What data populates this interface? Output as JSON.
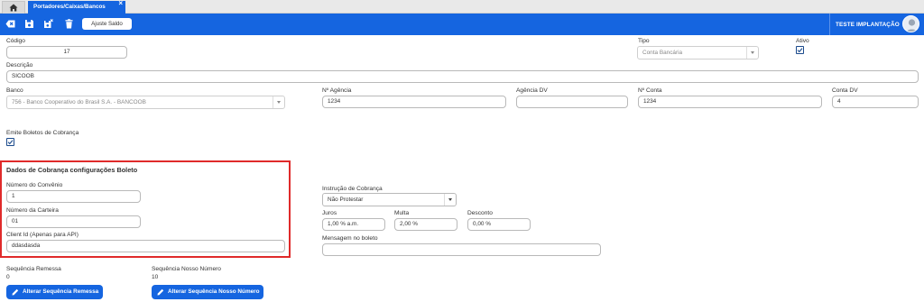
{
  "tabs": {
    "home_icon": "home-icon",
    "active_label": "Portadores/Caixas/Bancos",
    "close_glyph": "×"
  },
  "toolbar": {
    "icons": [
      "cancel-icon",
      "save-icon",
      "save-close-icon",
      "delete-icon"
    ],
    "ajuste_saldo_label": "Ajuste Saldo",
    "user_name": "TESTE IMPLANTAÇÃO",
    "color": "#1565e0"
  },
  "form": {
    "codigo": {
      "label": "Código",
      "value": "17"
    },
    "tipo": {
      "label": "Tipo",
      "value": "Conta Bancária"
    },
    "ativo": {
      "label": "Ativo",
      "checked": true
    },
    "descricao": {
      "label": "Descrição",
      "value": "SICOOB"
    },
    "banco": {
      "label": "Banco",
      "value": "756 - Banco Cooperativo do Brasil S.A. - BANCOOB"
    },
    "agencia": {
      "label": "Nº Agência",
      "value": "1234"
    },
    "agencia_dv": {
      "label": "Agência DV",
      "value": ""
    },
    "conta": {
      "label": "Nº Conta",
      "value": "1234"
    },
    "conta_dv": {
      "label": "Conta DV",
      "value": "4"
    },
    "emite_boletos": {
      "label": "Emite Boletos de Cobrança",
      "checked": true
    }
  },
  "cobranca": {
    "title": "Dados de Cobrança configurações Boleto",
    "numero_convenio": {
      "label": "Número do Convênio",
      "value": "1"
    },
    "numero_carteira": {
      "label": "Número da Carteira",
      "value": "01"
    },
    "client_id": {
      "label": "Client Id (Apenas para API)",
      "value": "ddasdasda"
    },
    "instrucao": {
      "label": "Instrução de Cobrança",
      "value": "Não Protestar"
    },
    "juros": {
      "label": "Juros",
      "value": "1,00 % a.m."
    },
    "multa": {
      "label": "Multa",
      "value": "2,00 %"
    },
    "desconto": {
      "label": "Desconto",
      "value": "0,00 %"
    },
    "mensagem": {
      "label": "Mensagem no boleto",
      "value": ""
    },
    "highlight_color": "#e02a2a"
  },
  "sequencias": {
    "remessa": {
      "label": "Sequência Remessa",
      "value": "0",
      "button": "Alterar Sequência Remessa"
    },
    "nosso_numero": {
      "label": "Sequência Nosso Número",
      "value": "10",
      "button": "Alterar Sequência Nosso Número"
    }
  }
}
